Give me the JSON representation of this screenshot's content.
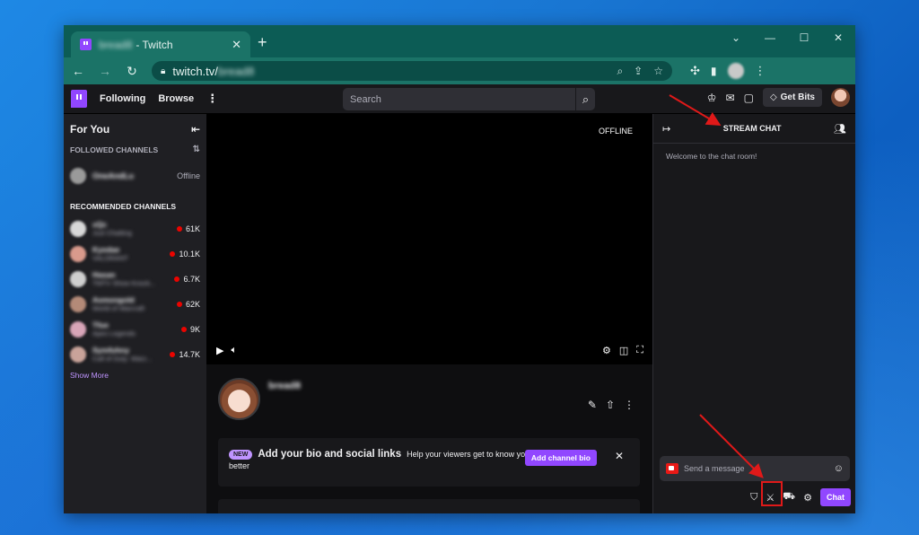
{
  "browser": {
    "tab_title_suffix": "- Twitch",
    "tab_name_blurred": "bread8",
    "url_prefix": "twitch.tv/",
    "url_suffix_blurred": "bread8"
  },
  "nav": {
    "following": "Following",
    "browse": "Browse",
    "more": "⋮",
    "search_placeholder": "Search",
    "get_bits": "Get Bits"
  },
  "sidebar": {
    "for_you": "For You",
    "followed_title": "FOLLOWED CHANNELS",
    "followed": [
      {
        "name": "OneAndLu",
        "status": "Offline",
        "color": "#9a9a9a"
      }
    ],
    "recommended_title": "RECOMMENDED CHANNELS",
    "recommended": [
      {
        "name": "xQc",
        "game": "Just Chatting",
        "viewers": "61K",
        "color": "#d8d8d8"
      },
      {
        "name": "Kyedae",
        "game": "VALORANT",
        "viewers": "10.1K",
        "color": "#d99a8c"
      },
      {
        "name": "Hasan",
        "game": "TMTV Show Knock...",
        "viewers": "6.7K",
        "color": "#cfcfcf"
      },
      {
        "name": "Asmongold",
        "game": "World of Warcraft",
        "viewers": "62K",
        "color": "#b48a78"
      },
      {
        "name": "Tfue",
        "game": "Apex Legends",
        "viewers": "9K",
        "color": "#d8a5b8"
      },
      {
        "name": "Symfuhny",
        "game": "Call of Duty: Warz...",
        "viewers": "14.7K",
        "color": "#c9a39a"
      }
    ],
    "show_more": "Show More"
  },
  "player": {
    "offline": "OFFLINE"
  },
  "channel": {
    "name_blurred": "bread8"
  },
  "bio": {
    "badge": "NEW",
    "title": "Add your bio and social links",
    "subtitle": "Help your viewers get to know you",
    "subtitle2": "better",
    "button": "Add channel bio"
  },
  "chat": {
    "title": "STREAM CHAT",
    "welcome": "Welcome to the chat room!",
    "placeholder": "Send a message",
    "chat_button": "Chat"
  }
}
